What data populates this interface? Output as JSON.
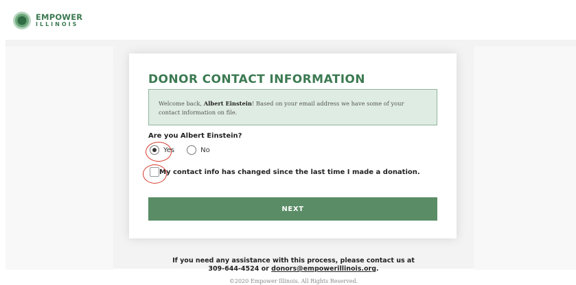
{
  "header": {
    "logo_top": "EMPOWER",
    "logo_bottom": "ILLINOIS",
    "brand_color": "#3c7a52"
  },
  "card": {
    "title": "DONOR CONTACT INFORMATION",
    "notice": {
      "prefix": "Welcome back, ",
      "name": "Albert Einstein",
      "suffix": "! Based on your email address we have some of your contact information on file."
    },
    "question": "Are you Albert Einstein?",
    "options": [
      {
        "label": "Yes",
        "checked": true
      },
      {
        "label": "No",
        "checked": false
      }
    ],
    "checkbox_label": "My contact info has changed since the last time I made a donation.",
    "checkbox_checked": false,
    "next_label": "NEXT",
    "button_color": "#5a8c66"
  },
  "footer": {
    "help_line1": "If you need any assistance with this process, please contact us at",
    "help_phone": "309-644-4524 or ",
    "help_email": "donors@empowerillinois.org",
    "help_end": ".",
    "copyright": "©2020 Empower Illinois. All Rights Reserved."
  },
  "annotation_color": "#d53a2c"
}
